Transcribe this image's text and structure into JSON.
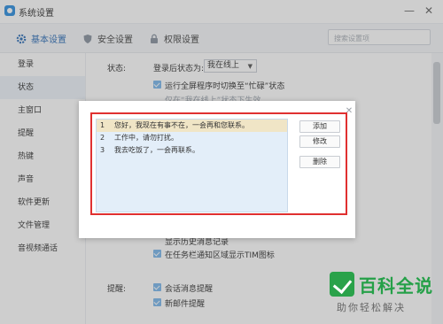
{
  "window": {
    "title": "系统设置",
    "minimize": "—",
    "close": "✕"
  },
  "tabs": [
    {
      "label": "基本设置",
      "icon": "gear-icon",
      "active": true
    },
    {
      "label": "安全设置",
      "icon": "shield-icon",
      "active": false
    },
    {
      "label": "权限设置",
      "icon": "lock-icon",
      "active": false
    }
  ],
  "search": {
    "placeholder": "搜索设置项"
  },
  "sidebar": {
    "items": [
      {
        "label": "登录"
      },
      {
        "label": "状态"
      },
      {
        "label": "主窗口"
      },
      {
        "label": "提醒"
      },
      {
        "label": "热键"
      },
      {
        "label": "声音"
      },
      {
        "label": "软件更新"
      },
      {
        "label": "文件管理"
      },
      {
        "label": "音视频通话"
      }
    ]
  },
  "status_section": {
    "heading": "状态:",
    "after_login_label": "登录后状态为:",
    "after_login_value": "我在线上",
    "fullscreen_busy": "运行全屏程序时切换至“忙碌”状态",
    "partial_hidden": "仅在“我在线上”状态下生效"
  },
  "history_row": {
    "partial": "显示历史消息记录"
  },
  "taskbar_row": {
    "label": "在任务栏通知区域显示TIM图标"
  },
  "remind_section": {
    "heading": "提醒:",
    "session_label": "会话消息提醒",
    "mail_label": "新邮件提醒"
  },
  "dialog": {
    "close": "✕",
    "phrases": [
      {
        "num": "1",
        "text": "您好，我现在有事不在，一会再和您联系。"
      },
      {
        "num": "2",
        "text": "工作中，请勿打扰。"
      },
      {
        "num": "3",
        "text": "我去吃饭了，一会再联系。"
      }
    ],
    "buttons": {
      "add": "添加",
      "edit": "修改",
      "delete": "删除"
    }
  },
  "watermark": {
    "title": "百科全说",
    "subtitle": "助你轻松解决"
  },
  "colors": {
    "accent": "#2f8fe0",
    "highlight_box": "#e03030",
    "selected_row": "#f0e5c6",
    "list_bg": "#e3eef9",
    "watermark": "#25a048"
  }
}
